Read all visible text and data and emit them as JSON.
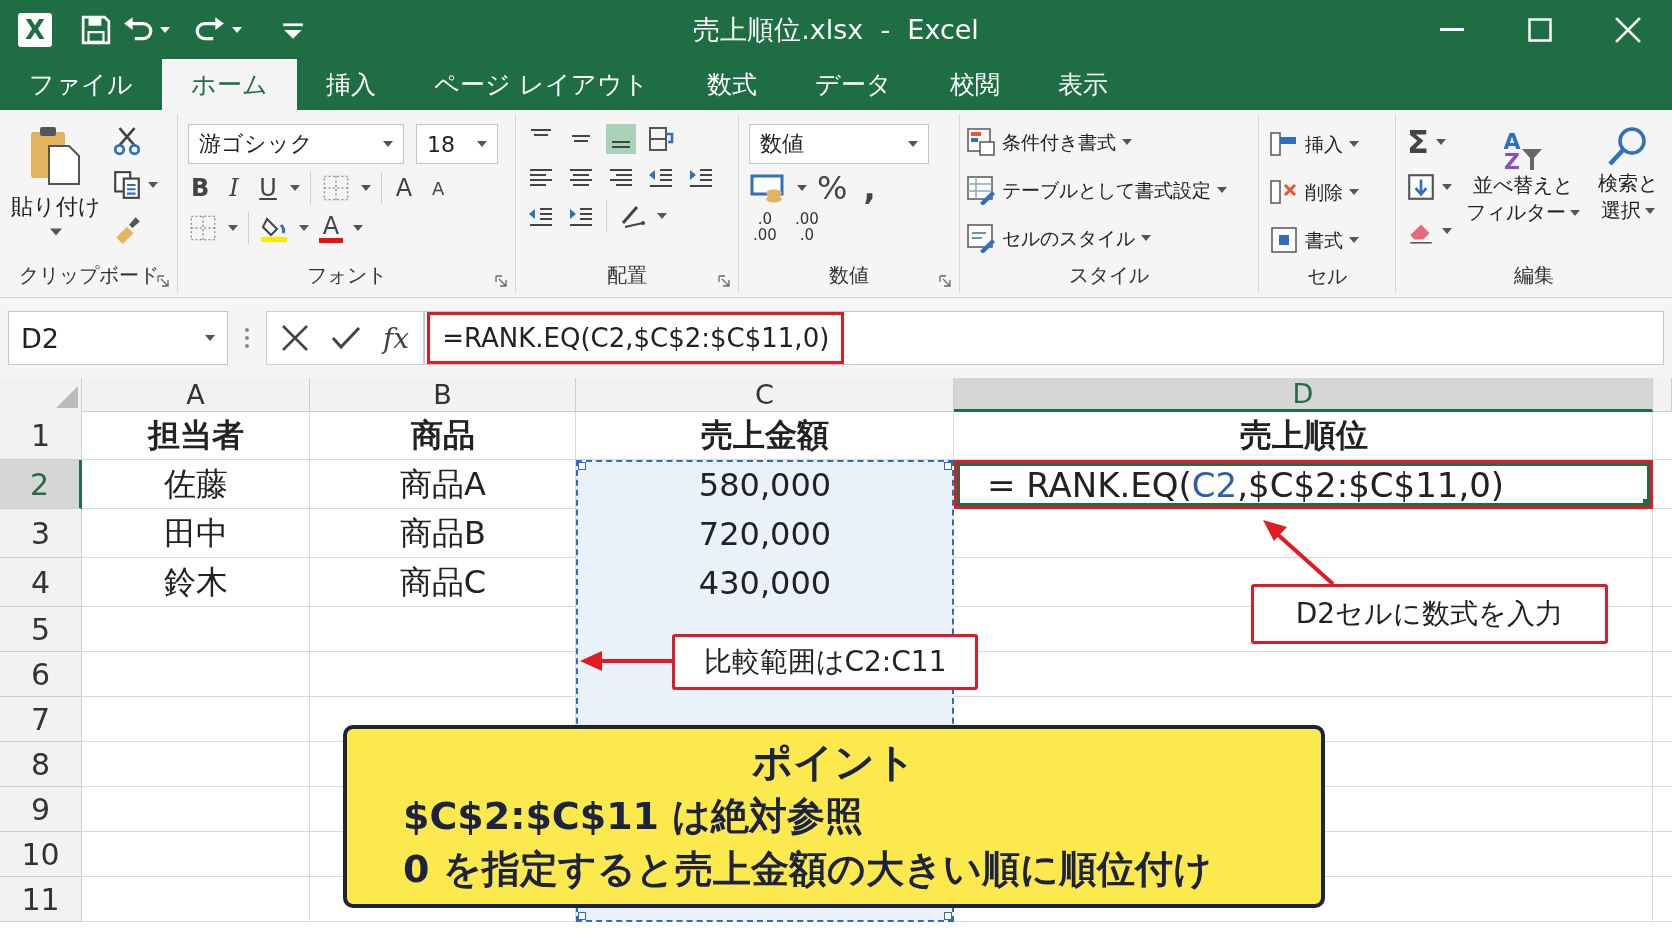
{
  "window": {
    "app_icon": "X",
    "title": "売上順位.xlsx  -  Excel"
  },
  "tabs": [
    {
      "label": "ファイル",
      "selected": false
    },
    {
      "label": "ホーム",
      "selected": true
    },
    {
      "label": "挿入",
      "selected": false
    },
    {
      "label": "ページ レイアウト",
      "selected": false
    },
    {
      "label": "数式",
      "selected": false
    },
    {
      "label": "データ",
      "selected": false
    },
    {
      "label": "校閲",
      "selected": false
    },
    {
      "label": "表示",
      "selected": false
    }
  ],
  "ribbon": {
    "clipboard": {
      "paste": "貼り付け",
      "label": "クリップボード"
    },
    "font": {
      "name": "游ゴシック",
      "size": "18",
      "bold": "B",
      "italic": "I",
      "underline": "U",
      "grow": "A",
      "shrink": "A",
      "font_color": "A",
      "label": "フォント"
    },
    "alignment": {
      "vertical": [
        {
          "selected": false
        },
        {
          "selected": false
        },
        {
          "selected": true
        }
      ],
      "label": "配置"
    },
    "number": {
      "format": "数値",
      "percent": "%",
      "comma": ",",
      "decimals": [
        {
          "top": ".0",
          "bottom": ".00"
        },
        {
          "top": ".00",
          "bottom": ".0"
        }
      ],
      "label": "数値"
    },
    "styles": {
      "items": [
        {
          "kind": "conditional",
          "label": "条件付き書式"
        },
        {
          "kind": "table",
          "label": "テーブルとして書式設定"
        },
        {
          "kind": "cell-style",
          "label": "セルのスタイル"
        }
      ],
      "label": "スタイル"
    },
    "cells": {
      "items": [
        {
          "kind": "insert",
          "label": "挿入"
        },
        {
          "kind": "delete",
          "label": "削除"
        },
        {
          "kind": "format",
          "label": "書式"
        }
      ],
      "label": "セル"
    },
    "editing": {
      "sum": "Σ",
      "sort": {
        "letters": [
          "A",
          "Z"
        ],
        "lines": [
          "並べ替えと",
          "フィルター"
        ]
      },
      "find": {
        "lines": [
          "検索と",
          "選択"
        ]
      },
      "label": "編集"
    }
  },
  "formula_bar": {
    "name_box": "D2",
    "function_label": "fx",
    "formula": "=RANK.EQ(C2,$C$2:$C$11,0)",
    "annotated": true
  },
  "sheet": {
    "columns": [
      {
        "label": "A",
        "selected": false
      },
      {
        "label": "B",
        "selected": false
      },
      {
        "label": "C",
        "selected": false
      },
      {
        "label": "D",
        "selected": true
      }
    ],
    "rows": [
      {
        "number": "1",
        "selected": false,
        "kind": "header",
        "cells": [
          {
            "kind": "text",
            "text": "担当者"
          },
          {
            "kind": "text",
            "text": "商品"
          },
          {
            "kind": "text",
            "text": "売上金額"
          },
          {
            "kind": "text",
            "text": "売上順位"
          }
        ]
      },
      {
        "number": "2",
        "selected": true,
        "kind": "data",
        "cells": [
          {
            "kind": "text",
            "text": "佐藤"
          },
          {
            "kind": "text",
            "text": "商品A"
          },
          {
            "kind": "text",
            "text": "580,000"
          },
          {
            "kind": "formula",
            "parts": [
              {
                "text": "= RANK.EQ(",
                "ref": false
              },
              {
                "text": "C2",
                "ref": true
              },
              {
                "text": ",$C$2:$C$11,0)",
                "ref": false
              }
            ]
          }
        ]
      },
      {
        "number": "3",
        "selected": false,
        "kind": "data",
        "cells": [
          {
            "kind": "text",
            "text": "田中"
          },
          {
            "kind": "text",
            "text": "商品B"
          },
          {
            "kind": "text",
            "text": "720,000"
          }
        ]
      },
      {
        "number": "4",
        "selected": false,
        "kind": "data",
        "cells": [
          {
            "kind": "text",
            "text": "鈴木"
          },
          {
            "kind": "text",
            "text": "商品C"
          },
          {
            "kind": "text",
            "text": "430,000"
          }
        ]
      },
      {
        "number": "5",
        "selected": false,
        "kind": "empty"
      },
      {
        "number": "6",
        "selected": false,
        "kind": "empty"
      },
      {
        "number": "7",
        "selected": false,
        "kind": "empty"
      },
      {
        "number": "8",
        "selected": false,
        "kind": "empty"
      },
      {
        "number": "9",
        "selected": false,
        "kind": "empty"
      },
      {
        "number": "10",
        "selected": false,
        "kind": "empty"
      },
      {
        "number": "11",
        "selected": false,
        "kind": "empty"
      }
    ]
  },
  "annotations": {
    "range_note": "比較範囲はC2:C11",
    "cell_note": "D2セルに数式を入力",
    "point": {
      "title": "ポイント",
      "lines": [
        "$C$2:$C$11 は絶対参照",
        "0 を指定すると売上金額の大きい順に順位付け"
      ]
    }
  }
}
